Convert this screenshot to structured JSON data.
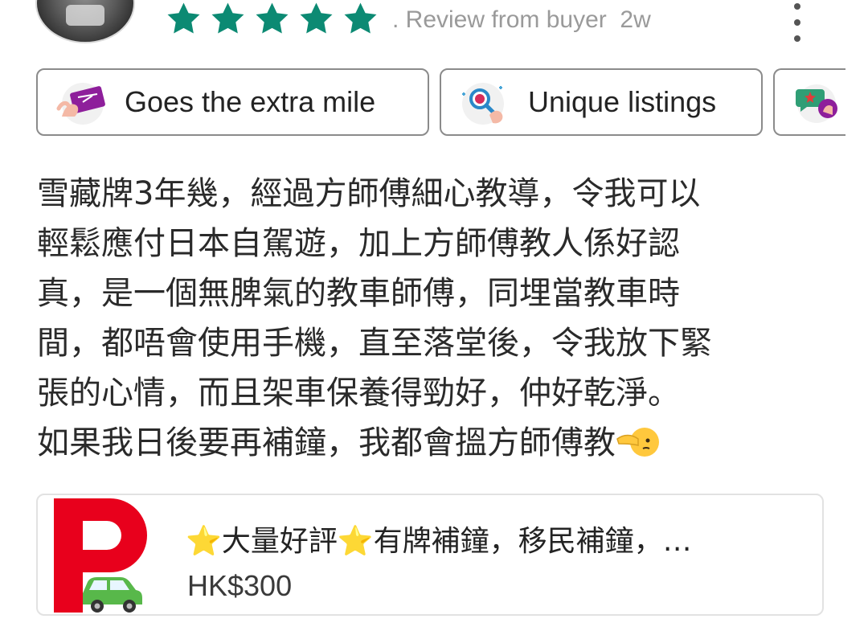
{
  "review": {
    "rating": 5,
    "meta_text": ". Review from buyer  2w",
    "star_color": "#0c8a73",
    "tags": [
      {
        "label": "Goes the extra mile",
        "icon": "ticket-hand-icon"
      },
      {
        "label": "Unique listings",
        "icon": "magnifier-hand-icon"
      },
      {
        "label": "",
        "icon": "star-speech-icon"
      }
    ],
    "body_lines": [
      "雪藏牌3年幾，經過方師傅細心教導，令我可以",
      "輕鬆應付日本自駕遊，加上方師傅教人係好認",
      "真，是一個無脾氣的教車師傅，同埋當教車時",
      "間，都唔會使用手機，直至落堂後，令我放下緊",
      "張的心情，而且架車保養得勁好，仲好乾淨。",
      "如果我日後要再補鐘，我都會搵方師傅教"
    ]
  },
  "listing": {
    "title": "⭐大量好評⭐有牌補鐘，移民補鐘，…",
    "price": "HK$300",
    "brand_color": "#e8001c",
    "car_color": "#58b84a"
  }
}
